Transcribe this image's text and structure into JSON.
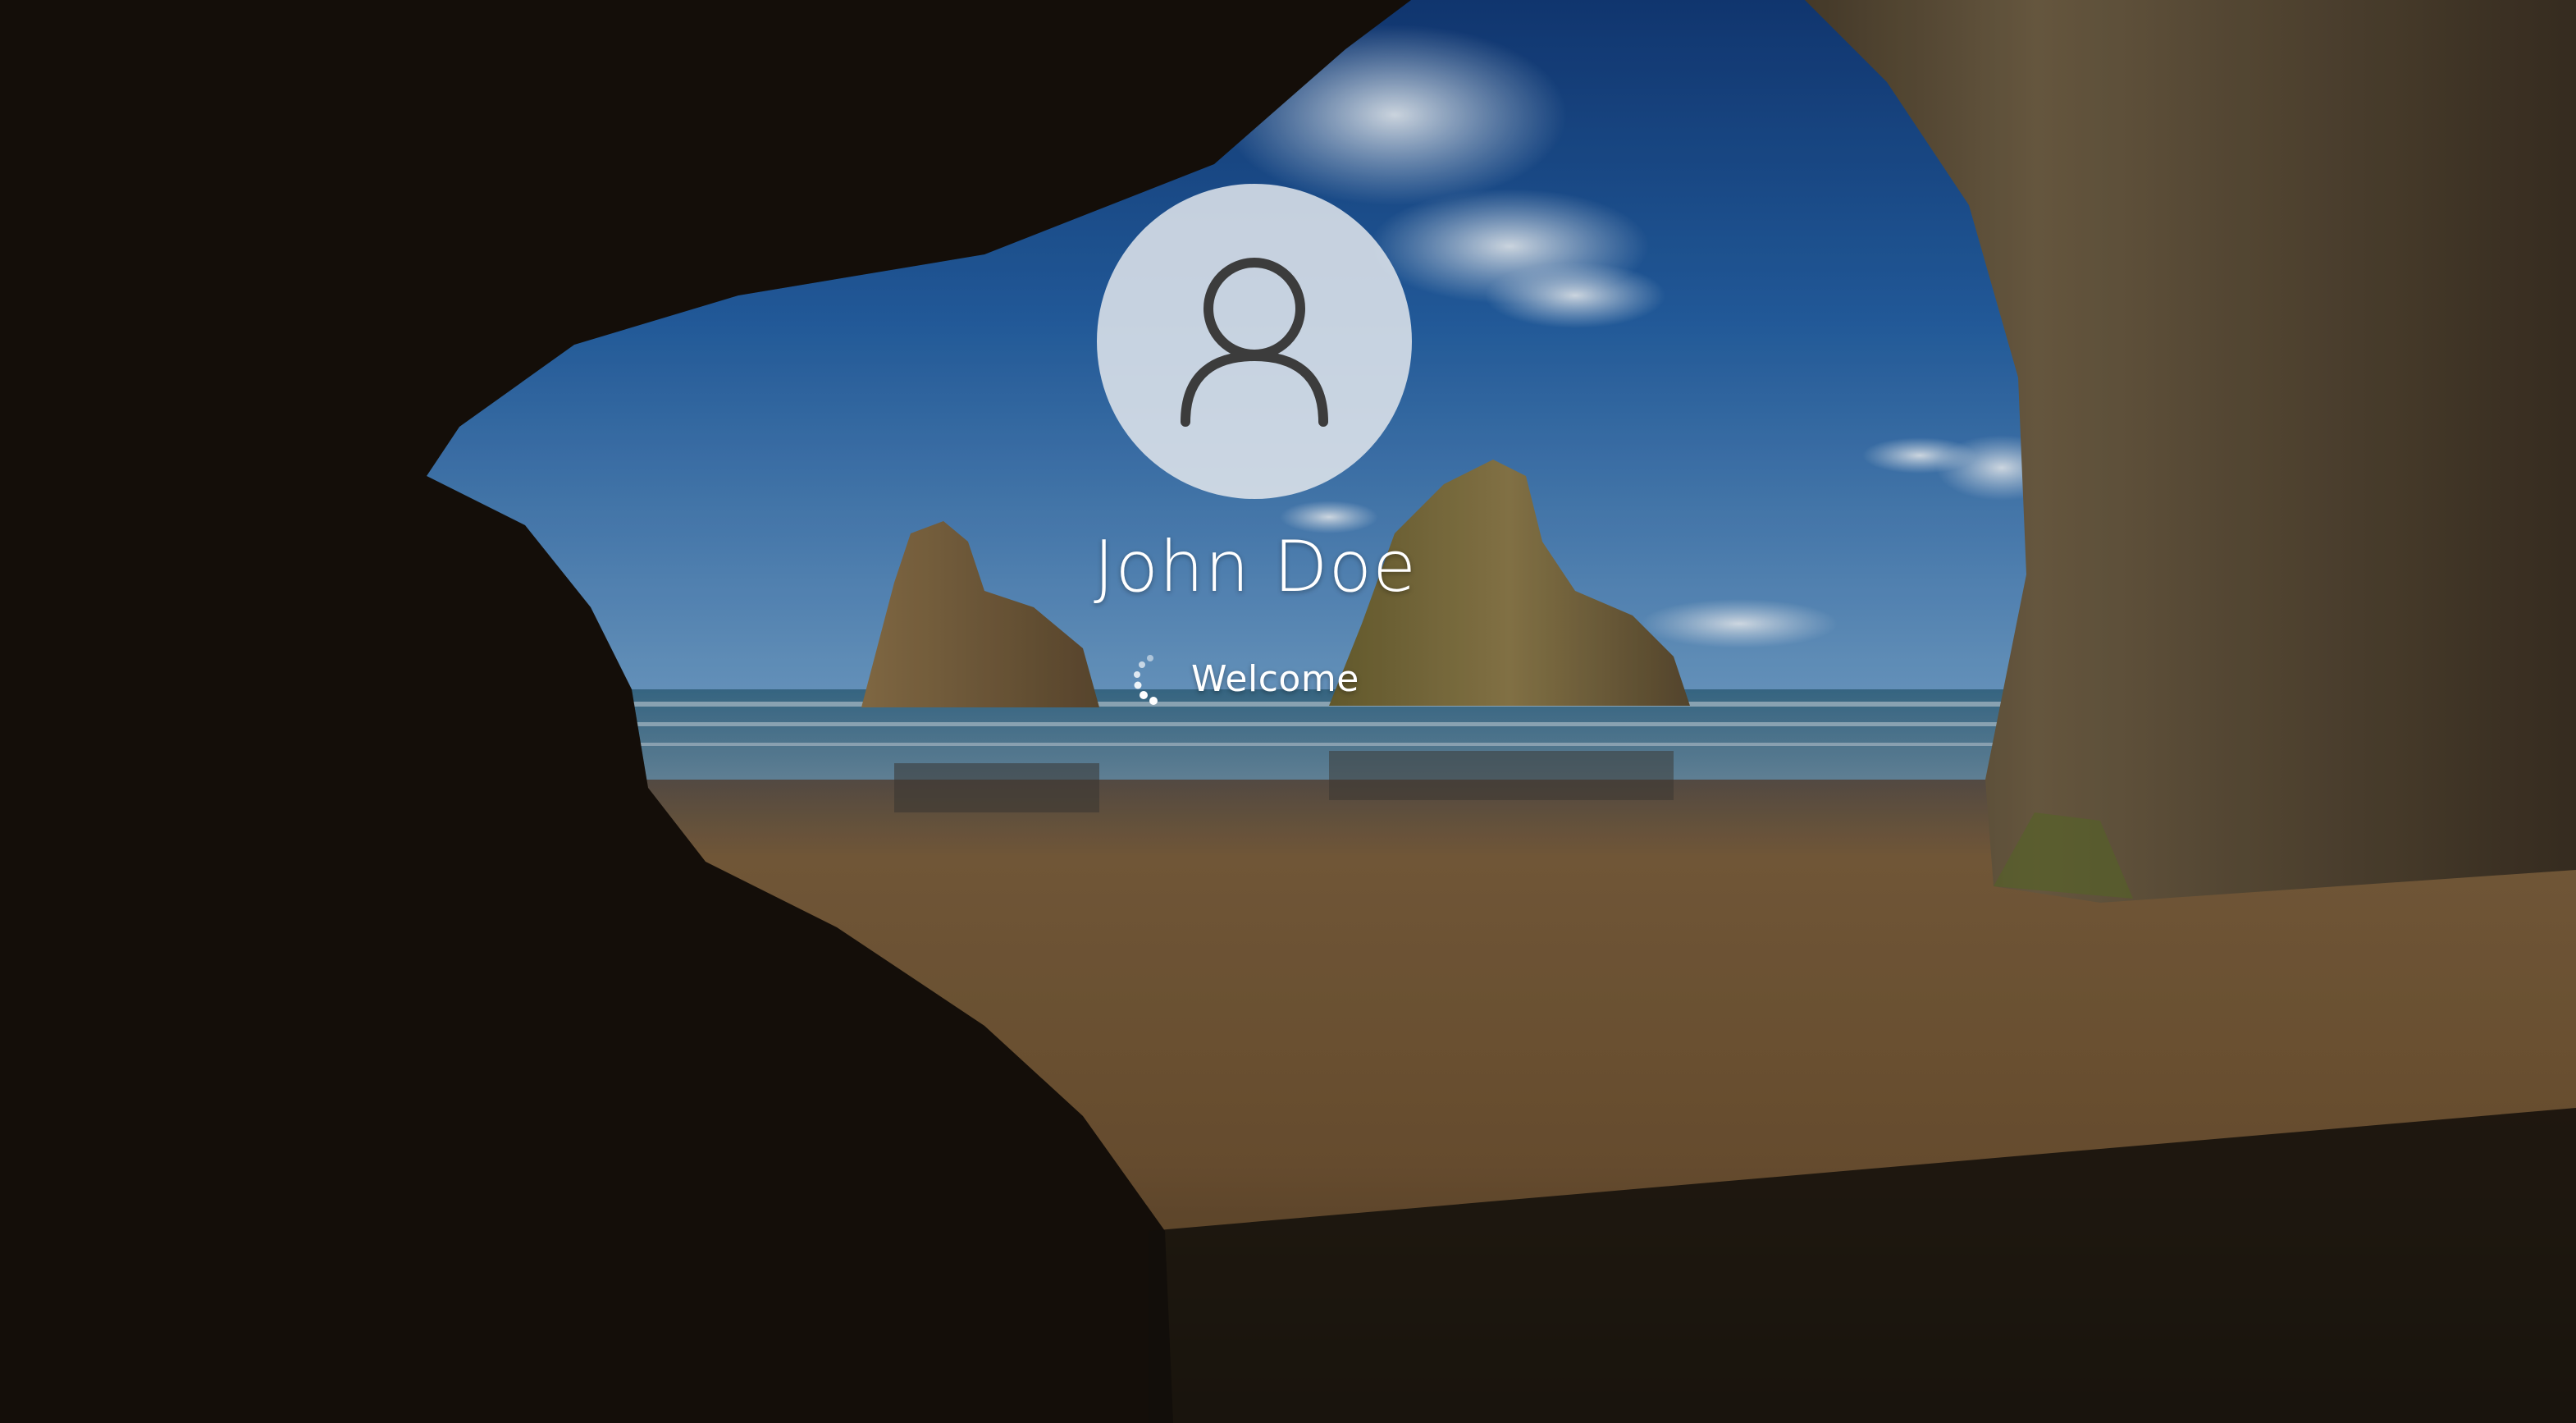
{
  "wallpaper": {
    "name": "cave-beach-wallpaper"
  },
  "user": {
    "avatar_icon": "user-icon",
    "name": "John Doe"
  },
  "status": {
    "spinner_icon": "loading-spinner-icon",
    "text": "Welcome"
  },
  "colors": {
    "text": "#ffffff",
    "avatar_bg": "#e2e6ec",
    "avatar_glyph": "#3c3c3c"
  }
}
